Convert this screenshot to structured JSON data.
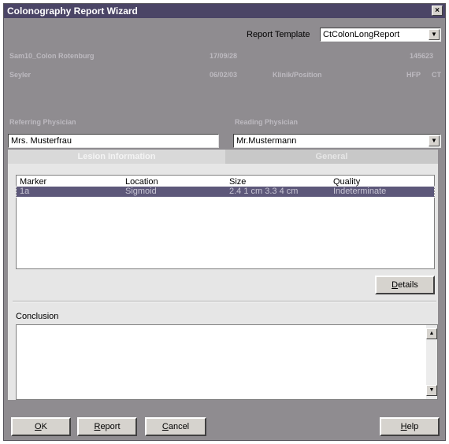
{
  "window": {
    "title": "Colonography Report Wizard",
    "close": "×"
  },
  "template": {
    "label": "Report Template",
    "value": "CtColonLongReport",
    "arrow": "▼"
  },
  "patient": {
    "row1": {
      "name": "Sam10_Colon Rotenburg",
      "date": "17/09/28",
      "id": "145623"
    },
    "row2": {
      "name": "Seyler",
      "date": "06/02/03",
      "extra": "Klinik/Position",
      "code1": "HFP",
      "code2": "CT"
    }
  },
  "referring": {
    "label": "Referring Physician",
    "value": "Mrs. Musterfrau"
  },
  "reading": {
    "label": "Reading Physician",
    "value": "Mr.Mustermann",
    "arrow": "▼"
  },
  "tabs": {
    "lesion": "Lesion Information",
    "general": "General"
  },
  "lesions": {
    "headers": {
      "marker": "Marker",
      "location": "Location",
      "size": "Size",
      "quality": "Quality"
    },
    "rows": [
      {
        "marker": "1a",
        "location": "Sigmoid",
        "size": "2.4 1 cm 3.3 4 cm",
        "quality": "Indeterminate"
      }
    ]
  },
  "details_button": {
    "prefix": "",
    "hotkey": "D",
    "rest": "etails"
  },
  "conclusion": {
    "label": "Conclusion",
    "up": "▲",
    "down": "▼"
  },
  "buttons": {
    "ok": {
      "hotkey": "O",
      "rest": "K"
    },
    "report": {
      "hotkey": "R",
      "rest": "eport"
    },
    "cancel": {
      "hotkey": "C",
      "rest": "ancel"
    },
    "help": {
      "hotkey": "H",
      "rest": "elp"
    }
  }
}
